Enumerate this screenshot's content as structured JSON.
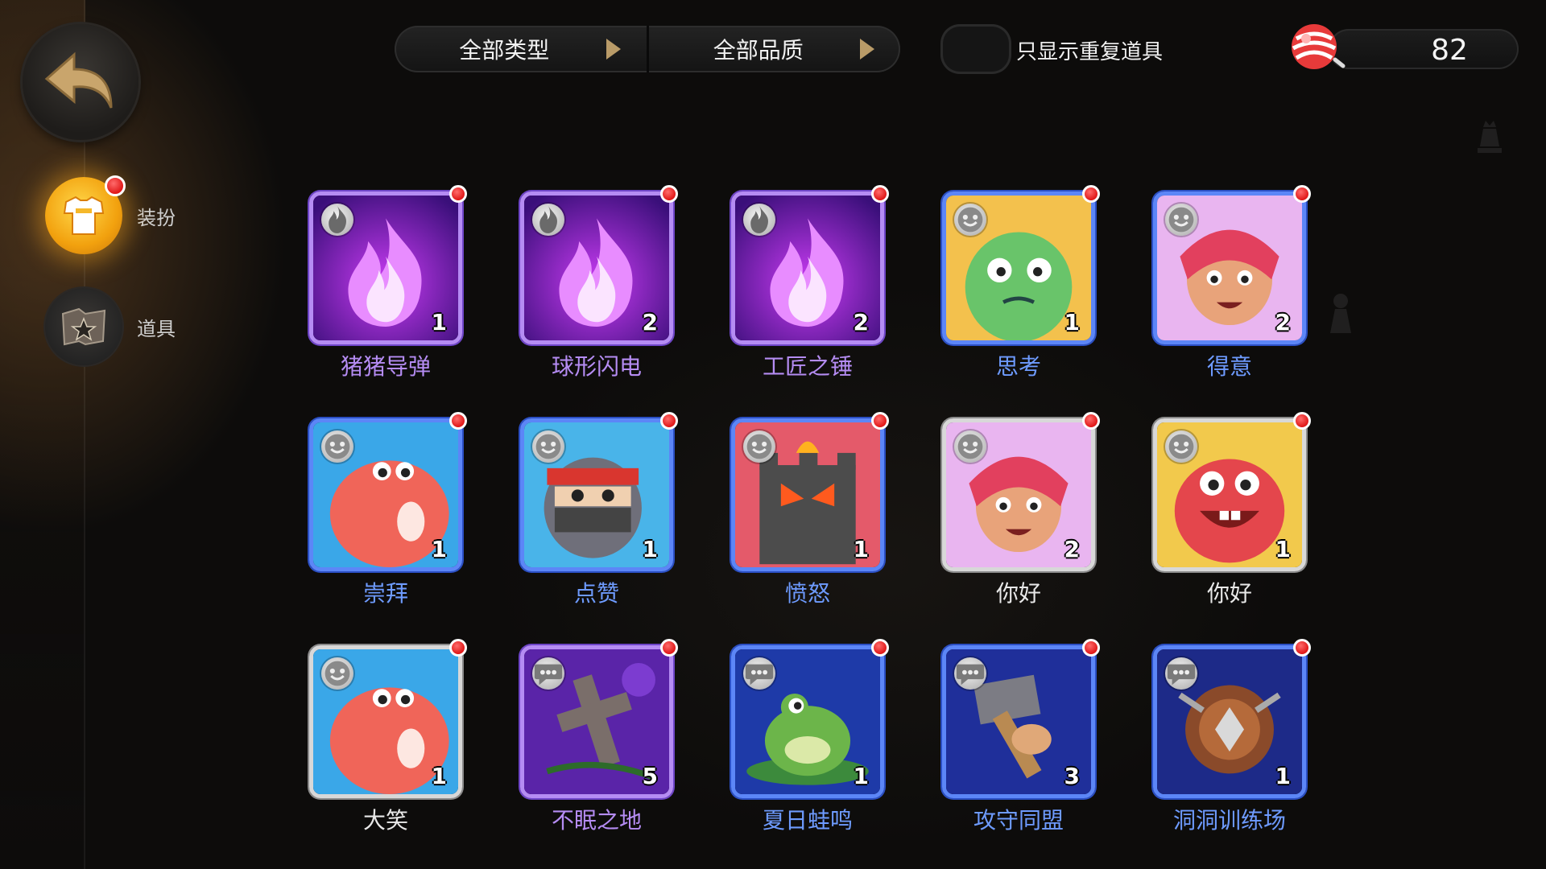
{
  "sidebar": {
    "items": [
      {
        "label": "装扮",
        "icon": "costume-icon",
        "active": true,
        "badge": true
      },
      {
        "label": "道具",
        "icon": "item-bag-icon",
        "active": false,
        "badge": false
      }
    ]
  },
  "filters": {
    "type_label": "全部类型",
    "quality_label": "全部品质"
  },
  "toggle": {
    "label": "只显示重复道具",
    "on": false
  },
  "currency": {
    "icon": "candy-icon",
    "value": "82"
  },
  "items": [
    {
      "name": "猪猪导弹",
      "count": "1",
      "rarity": "purple",
      "type": "fire",
      "art": "flame"
    },
    {
      "name": "球形闪电",
      "count": "2",
      "rarity": "purple",
      "type": "fire",
      "art": "flame"
    },
    {
      "name": "工匠之锤",
      "count": "2",
      "rarity": "purple",
      "type": "fire",
      "art": "flame"
    },
    {
      "name": "思考",
      "count": "1",
      "rarity": "blue",
      "type": "emote",
      "art": "goblin"
    },
    {
      "name": "得意",
      "count": "2",
      "rarity": "blue",
      "type": "emote",
      "art": "girl"
    },
    {
      "name": "崇拜",
      "count": "1",
      "rarity": "blue",
      "type": "emote",
      "art": "dino"
    },
    {
      "name": "点赞",
      "count": "1",
      "rarity": "blue",
      "type": "emote",
      "art": "ninja"
    },
    {
      "name": "愤怒",
      "count": "1",
      "rarity": "blue",
      "type": "emote",
      "art": "tower"
    },
    {
      "name": "你好",
      "count": "2",
      "rarity": "white",
      "type": "emote",
      "art": "girl"
    },
    {
      "name": "你好",
      "count": "1",
      "rarity": "white",
      "type": "emote",
      "art": "hippo"
    },
    {
      "name": "大笑",
      "count": "1",
      "rarity": "white",
      "type": "emote",
      "art": "dino"
    },
    {
      "name": "不眠之地",
      "count": "5",
      "rarity": "purple",
      "type": "chat",
      "art": "grave"
    },
    {
      "name": "夏日蛙鸣",
      "count": "1",
      "rarity": "blue",
      "type": "chat",
      "art": "frog"
    },
    {
      "name": "攻守同盟",
      "count": "3",
      "rarity": "blue",
      "type": "chat",
      "art": "hammer"
    },
    {
      "name": "洞洞训练场",
      "count": "1",
      "rarity": "blue",
      "type": "chat",
      "art": "shield"
    }
  ]
}
